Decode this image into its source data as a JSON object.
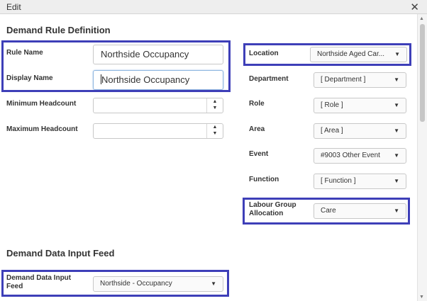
{
  "window": {
    "title": "Edit",
    "close_icon": "✕"
  },
  "sections": {
    "definition_title": "Demand Rule Definition",
    "feed_title": "Demand Data Input Feed"
  },
  "fields": {
    "rule_name": {
      "label": "Rule Name",
      "value": "Northside Occupancy"
    },
    "display_name": {
      "label": "Display Name",
      "value": "Northside Occupancy"
    },
    "minimum_headcount": {
      "label": "Minimum Headcount",
      "value": ""
    },
    "maximum_headcount": {
      "label": "Maximum Headcount",
      "value": ""
    },
    "location": {
      "label": "Location",
      "value": "Northside Aged Car..."
    },
    "department": {
      "label": "Department",
      "value": "[ Department ]"
    },
    "role": {
      "label": "Role",
      "value": "[ Role ]"
    },
    "area": {
      "label": "Area",
      "value": "[ Area ]"
    },
    "event": {
      "label": "Event",
      "value": "#9003 Other Event"
    },
    "function": {
      "label": "Function",
      "value": "[ Function ]"
    },
    "labour_group": {
      "label_line1": "Labour Group",
      "label_line2": "Allocation",
      "value": "Care"
    },
    "demand_feed": {
      "label_line1": "Demand Data Input",
      "label_line2": "Feed",
      "value": "Northside - Occupancy"
    }
  },
  "icons": {
    "dropdown": "▼",
    "spin_up": "▲",
    "spin_down": "▼"
  },
  "colors": {
    "highlight": "#3e3fb8",
    "focus_border": "#8fb6e0"
  }
}
